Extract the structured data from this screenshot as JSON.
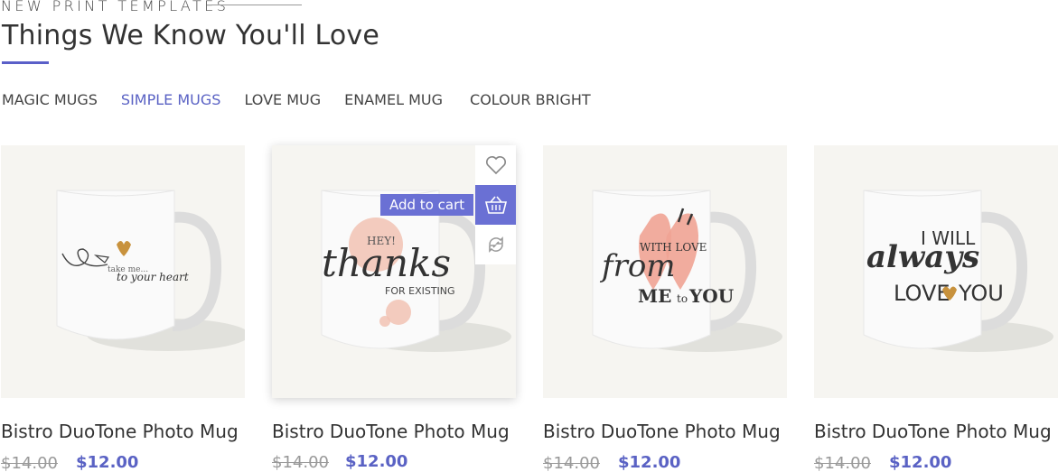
{
  "section": {
    "eyebrow": "NEW PRINT TEMPLATES",
    "title": "Things We Know You'll Love"
  },
  "tabs": [
    {
      "label": "MAGIC MUGS",
      "active": false
    },
    {
      "label": "SIMPLE MUGS",
      "active": true
    },
    {
      "label": "LOVE MUG",
      "active": false
    },
    {
      "label": "ENAMEL MUG",
      "active": false
    },
    {
      "label": "COLOUR BRIGHT",
      "active": false
    }
  ],
  "products": [
    {
      "name": "Bistro DuoTone Photo Mug",
      "old_price": "$14.00",
      "price": "$12.00",
      "print": {
        "line1": "take me...",
        "line2": "to your heart"
      }
    },
    {
      "name": "Bistro DuoTone Photo Mug",
      "old_price": "$14.00",
      "price": "$12.00",
      "print": {
        "small": "HEY!",
        "big": "thanks",
        "line2": "FOR EXISTING"
      }
    },
    {
      "name": "Bistro DuoTone Photo Mug",
      "old_price": "$14.00",
      "price": "$12.00",
      "print": {
        "line1": "WITH LOVE",
        "big": "from",
        "line2": "ME",
        "line3": "to",
        "line4": "YOU"
      }
    },
    {
      "name": "Bistro DuoTone Photo Mug",
      "old_price": "$14.00",
      "price": "$12.00",
      "print": {
        "line1": "I WILL",
        "big": "always",
        "line2": "LOVE",
        "line3": "YOU"
      }
    }
  ],
  "hover_actions": {
    "add_to_cart_label": "Add to cart"
  },
  "colors": {
    "accent": "#5a62c4",
    "button_bg": "#6a70d4",
    "image_bg": "#f6f5f1"
  }
}
